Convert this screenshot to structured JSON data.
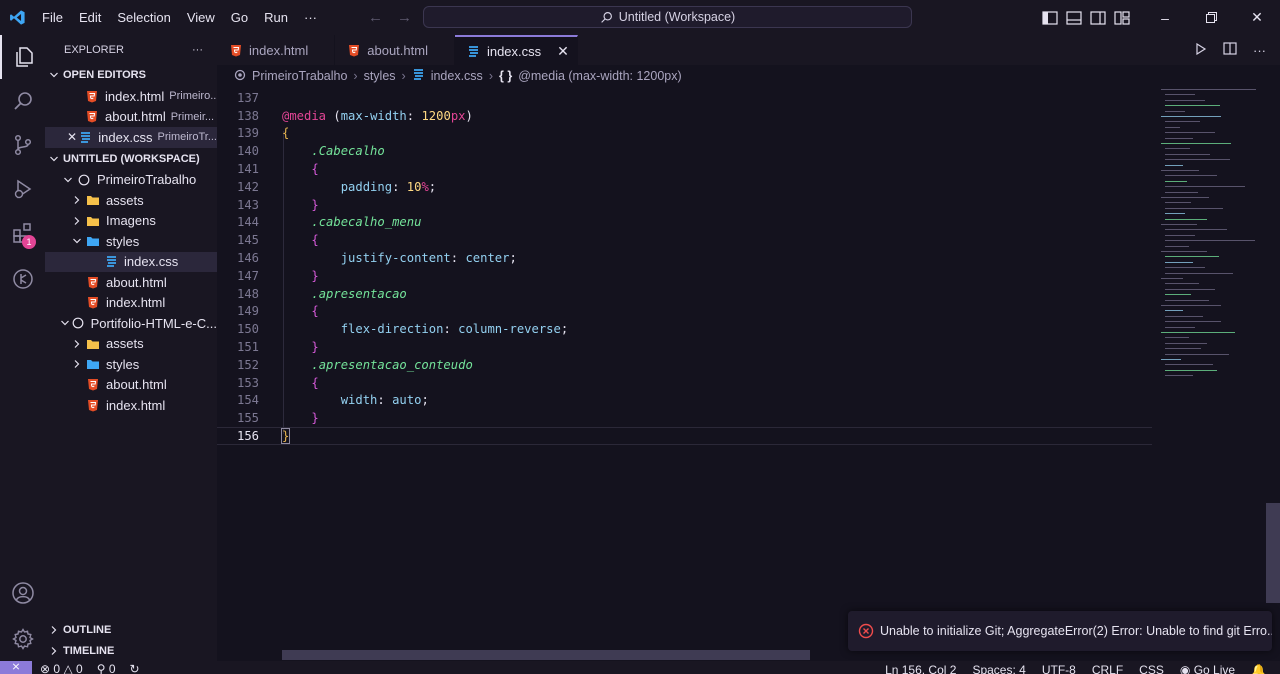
{
  "menu": [
    "File",
    "Edit",
    "Selection",
    "View",
    "Go",
    "Run",
    "···"
  ],
  "command_center": "Untitled (Workspace)",
  "explorer": {
    "title": "EXPLORER",
    "more": "···",
    "open_editors_title": "OPEN EDITORS",
    "open_editors": [
      {
        "name": "index.html",
        "desc": "Primeiro..."
      },
      {
        "name": "about.html",
        "desc": "Primeir..."
      },
      {
        "name": "index.css",
        "desc": "PrimeiroTr...",
        "close": "✕"
      }
    ],
    "workspace_title": "UNTITLED (WORKSPACE)",
    "tree": [
      {
        "label": "PrimeiroTrabalho",
        "indent": 1,
        "kind": "root",
        "chev": "open"
      },
      {
        "label": "assets",
        "indent": 2,
        "kind": "folder",
        "chev": "closed"
      },
      {
        "label": "Imagens",
        "indent": 2,
        "kind": "folder",
        "chev": "closed"
      },
      {
        "label": "styles",
        "indent": 2,
        "kind": "folder-styles",
        "chev": "open"
      },
      {
        "label": "index.css",
        "indent": 3,
        "kind": "css",
        "selected": true
      },
      {
        "label": "about.html",
        "indent": 2,
        "kind": "html"
      },
      {
        "label": "index.html",
        "indent": 2,
        "kind": "html"
      },
      {
        "label": "Portifolio-HTML-e-C...",
        "indent": 1,
        "kind": "root",
        "chev": "open"
      },
      {
        "label": "assets",
        "indent": 2,
        "kind": "folder",
        "chev": "closed"
      },
      {
        "label": "styles",
        "indent": 2,
        "kind": "folder-styles",
        "chev": "closed"
      },
      {
        "label": "about.html",
        "indent": 2,
        "kind": "html"
      },
      {
        "label": "index.html",
        "indent": 2,
        "kind": "html"
      }
    ],
    "outline": "OUTLINE",
    "timeline": "TIMELINE"
  },
  "activity_badge": "1",
  "tabs": [
    {
      "label": "index.html",
      "kind": "html"
    },
    {
      "label": "about.html",
      "kind": "html"
    },
    {
      "label": "index.css",
      "kind": "css",
      "active": true,
      "close": "✕"
    }
  ],
  "breadcrumb": {
    "folder": "PrimeiroTrabalho",
    "sub": "styles",
    "file": "index.css",
    "symbol_icon": "{ }",
    "symbol": "@media (max-width: 1200px)"
  },
  "editor": {
    "lines": [
      {
        "n": "137",
        "t": ""
      },
      {
        "n": "138",
        "t": "@media (max-width: 1200px)"
      },
      {
        "n": "139",
        "t": "{"
      },
      {
        "n": "140",
        "t": "    .Cabecalho"
      },
      {
        "n": "141",
        "t": "    {"
      },
      {
        "n": "142",
        "t": "        padding: 10%;"
      },
      {
        "n": "143",
        "t": "    }"
      },
      {
        "n": "144",
        "t": "    .cabecalho_menu"
      },
      {
        "n": "145",
        "t": "    {"
      },
      {
        "n": "146",
        "t": "        justify-content: center;"
      },
      {
        "n": "147",
        "t": "    }"
      },
      {
        "n": "148",
        "t": "    .apresentacao"
      },
      {
        "n": "149",
        "t": "    {"
      },
      {
        "n": "150",
        "t": "        flex-direction: column-reverse;"
      },
      {
        "n": "151",
        "t": "    }"
      },
      {
        "n": "152",
        "t": "    .apresentacao_conteudo"
      },
      {
        "n": "153",
        "t": "    {"
      },
      {
        "n": "154",
        "t": "        width: auto;"
      },
      {
        "n": "155",
        "t": "    }"
      },
      {
        "n": "156",
        "t": "}"
      }
    ],
    "current_line": "156"
  },
  "notification": "Unable to initialize Git; AggregateError(2) Error: Unable to find git Erro...",
  "status": {
    "remote": "⨯",
    "errors": "0",
    "warnings": "0",
    "ports": "0",
    "position": "Ln 156, Col 2",
    "spaces": "Spaces: 4",
    "encoding": "UTF-8",
    "eol": "CRLF",
    "language": "CSS",
    "live": "Go Live"
  },
  "colors": {
    "background": "#14121e",
    "sidebar": "#191622",
    "accent": "#8c7bd9",
    "keyword": "#e24595",
    "selector": "#74e39a",
    "property": "#93d0f0",
    "value": "#ffd983"
  }
}
